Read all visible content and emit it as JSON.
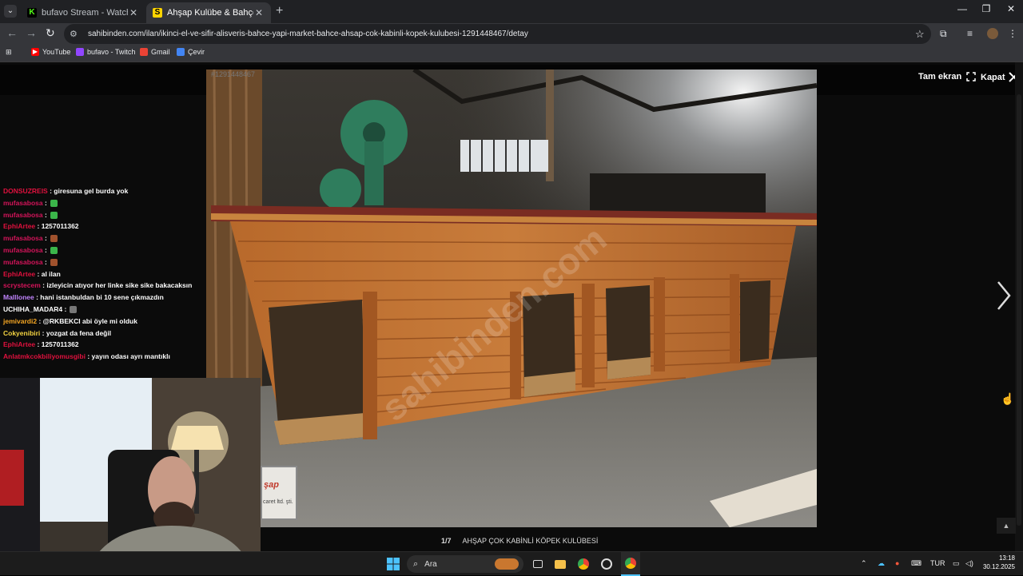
{
  "browser": {
    "tabs": [
      {
        "title": "bufavo Stream - Watch Live on",
        "favicon": "K",
        "favicon_color": "#53fc18"
      },
      {
        "title": "Ahşap Kulübe & Bahçe Mobilya",
        "favicon": "S",
        "favicon_color": "#ffd400"
      }
    ],
    "new_tab": "+",
    "url": "sahibinden.com/ilan/ikinci-el-ve-sifir-alisveris-bahce-yapi-market-bahce-ahsap-cok-kabinli-kopek-kulubesi-1291448467/detay",
    "bookmarks": [
      {
        "label": "YouTube",
        "icon": "youtube-icon",
        "color": "#ff0000"
      },
      {
        "label": "bufavo - Twitch",
        "icon": "twitch-icon",
        "color": "#9146ff"
      },
      {
        "label": "Gmail",
        "icon": "gmail-icon",
        "color": "#ea4335"
      },
      {
        "label": "Çevir",
        "icon": "translate-icon",
        "color": "#4285f4"
      }
    ]
  },
  "viewer": {
    "listing_no": "#1291448467",
    "fullscreen_label": "Tam ekran",
    "close_label": "Kapat",
    "counter": "1/7",
    "caption": "AHŞAP ÇOK KABİNLİ KÖPEK KULÜBESİ",
    "watermark": "sahibinden.com",
    "sign_text_1": "şap",
    "sign_text_2": "caret ltd. şti."
  },
  "chat": [
    {
      "user": "DONSUZREIS",
      "color": "#e0113e",
      "text": ": giresuna gel burda yok"
    },
    {
      "user": "mufasabosa",
      "color": "#d4145a",
      "text": ":",
      "emote": "#3bb54a"
    },
    {
      "user": "mufasabosa",
      "color": "#d4145a",
      "text": ":",
      "emote": "#3bb54a"
    },
    {
      "user": "EphiArtee",
      "color": "#e0113e",
      "text": ": 1257011362"
    },
    {
      "user": "mufasabosa",
      "color": "#d4145a",
      "text": ":",
      "emote": "#a0522d"
    },
    {
      "user": "mufasabosa",
      "color": "#d4145a",
      "text": ":",
      "emote": "#3bb54a"
    },
    {
      "user": "mufasabosa",
      "color": "#d4145a",
      "text": ":",
      "emote": "#a0522d"
    },
    {
      "user": "EphiArtee",
      "color": "#e0113e",
      "text": ": al ilan"
    },
    {
      "user": "scrystecem",
      "color": "#d4145a",
      "text": ": izleyicin atıyor her linke sike sike bakacaksın"
    },
    {
      "user": "Malllonee",
      "color": "#c084fc",
      "text": ": hani istanbuldan bi 10 sene çıkmazdın"
    },
    {
      "user": "UCHIHA_MADAR4",
      "color": "#ffffff",
      "text": ":",
      "emote": "#777777"
    },
    {
      "user": "jemivardi2",
      "color": "#f5a623",
      "text": ": @RKBEKCI abi öyle mi olduk"
    },
    {
      "user": "Cokyenibiri",
      "color": "#f5d442",
      "text": ": yozgat da fena değil"
    },
    {
      "user": "EphiArtee",
      "color": "#e0113e",
      "text": ": 1257011362"
    },
    {
      "user": "Anlatmkcokbiliyomusgibi",
      "color": "#e0113e",
      "text": ": yayın odası ayrı mantıklı"
    }
  ],
  "taskbar": {
    "search_label": "Ara",
    "language": "TUR",
    "time": "13:18",
    "date": "30.12.2025"
  }
}
